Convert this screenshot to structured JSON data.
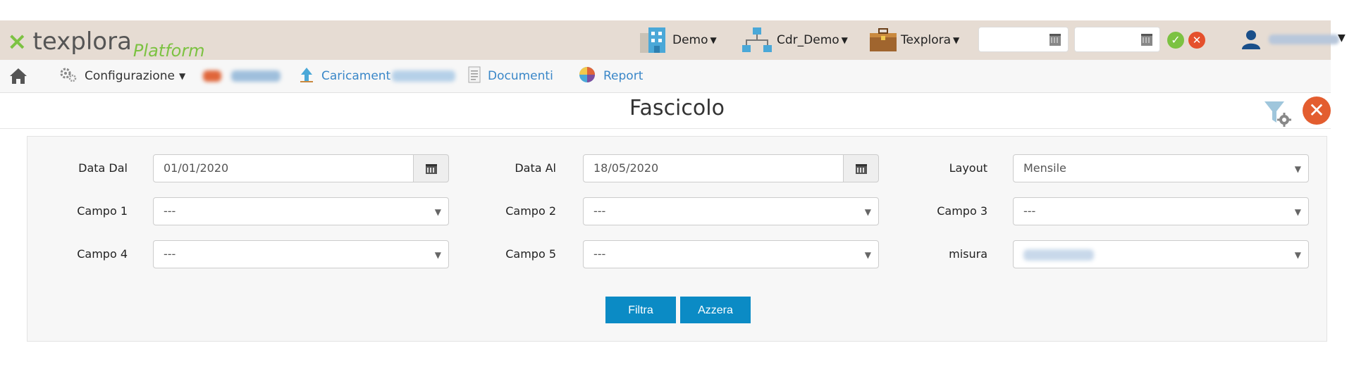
{
  "header": {
    "logo_main": "texplora",
    "logo_sub": "Platform",
    "contexts": [
      {
        "label": "Demo"
      },
      {
        "label": "Cdr_Demo"
      },
      {
        "label": "Texplora"
      }
    ],
    "date_from": "",
    "date_to": ""
  },
  "nav": {
    "items": [
      {
        "label": "Configurazione"
      },
      {
        "label": "Caricament"
      },
      {
        "label": "Documenti"
      },
      {
        "label": "Report"
      }
    ]
  },
  "page": {
    "title": "Fascicolo"
  },
  "form": {
    "data_dal_label": "Data Dal",
    "data_dal_value": "01/01/2020",
    "data_al_label": "Data Al",
    "data_al_value": "18/05/2020",
    "layout_label": "Layout",
    "layout_value": "Mensile",
    "campo1_label": "Campo 1",
    "campo1_value": "---",
    "campo2_label": "Campo 2",
    "campo2_value": "---",
    "campo3_label": "Campo 3",
    "campo3_value": "---",
    "campo4_label": "Campo 4",
    "campo4_value": "---",
    "campo5_label": "Campo 5",
    "campo5_value": "---",
    "misura_label": "misura",
    "filtra_label": "Filtra",
    "azzera_label": "Azzera"
  },
  "colors": {
    "accent": "#0b8bc5",
    "brand_green": "#7cc242",
    "danger": "#e35d2f",
    "header_bg": "#e6dcd3"
  }
}
